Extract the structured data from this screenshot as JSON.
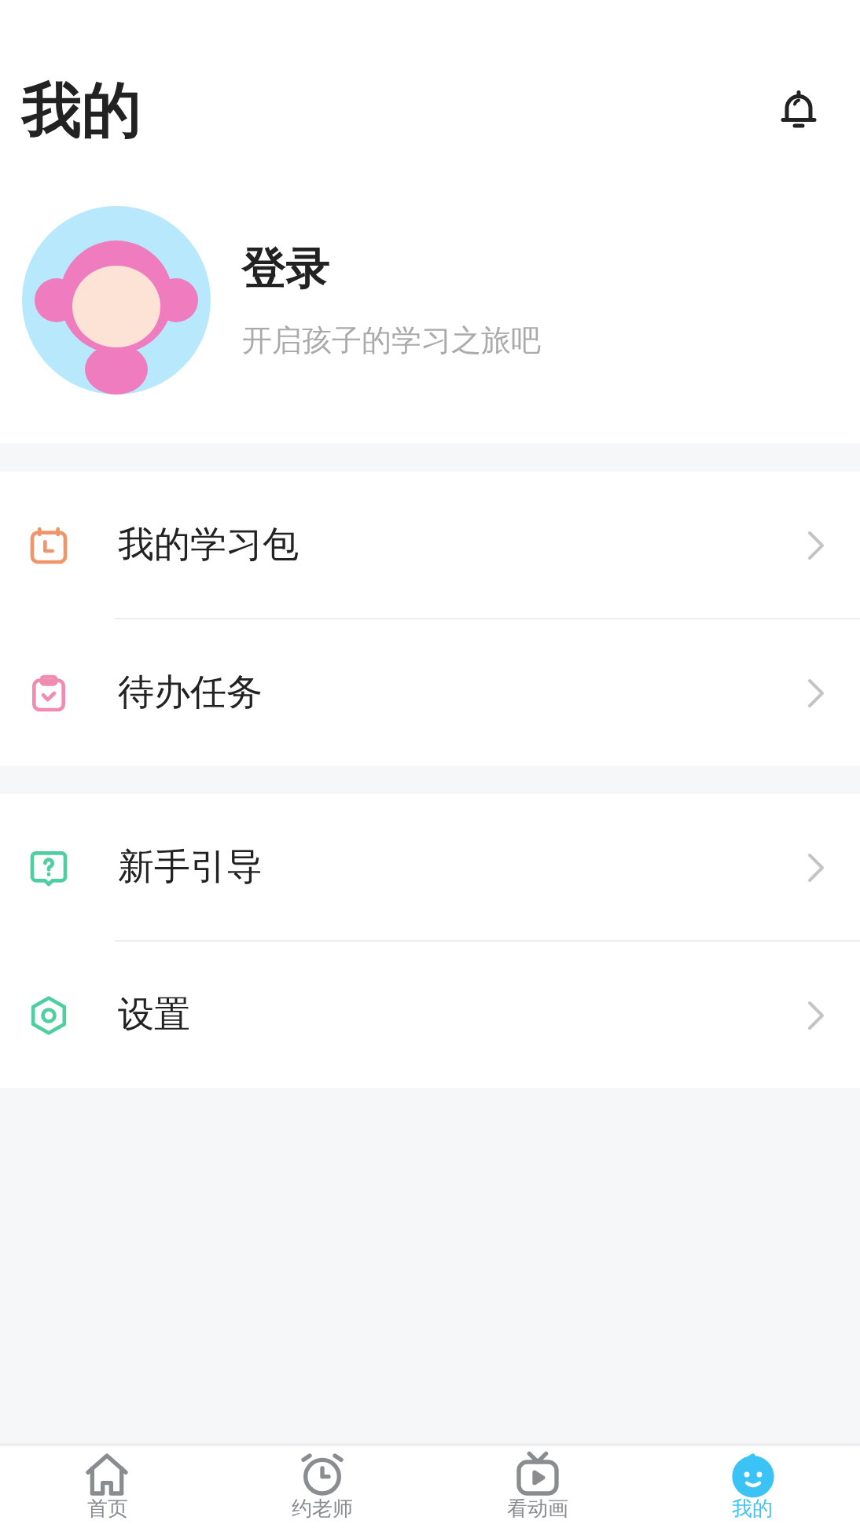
{
  "header": {
    "title": "我的"
  },
  "profile": {
    "name": "登录",
    "subtitle": "开启孩子的学习之旅吧"
  },
  "menu_groups": [
    {
      "items": [
        {
          "kind": "calendar",
          "color": "#f0956a",
          "label": "我的学习包"
        },
        {
          "kind": "clipboard",
          "color": "#f08cb0",
          "label": "待办任务"
        }
      ]
    },
    {
      "items": [
        {
          "kind": "question",
          "color": "#4fcf9f",
          "label": "新手引导"
        },
        {
          "kind": "settings",
          "color": "#4fcf9f",
          "label": "设置"
        }
      ]
    }
  ],
  "tab_bar": [
    {
      "kind": "home",
      "label": "首页",
      "selected": false
    },
    {
      "kind": "alarm",
      "label": "约老师",
      "selected": false
    },
    {
      "kind": "tv",
      "label": "看动画",
      "selected": false
    },
    {
      "kind": "baby",
      "label": "我的",
      "selected": true
    }
  ]
}
